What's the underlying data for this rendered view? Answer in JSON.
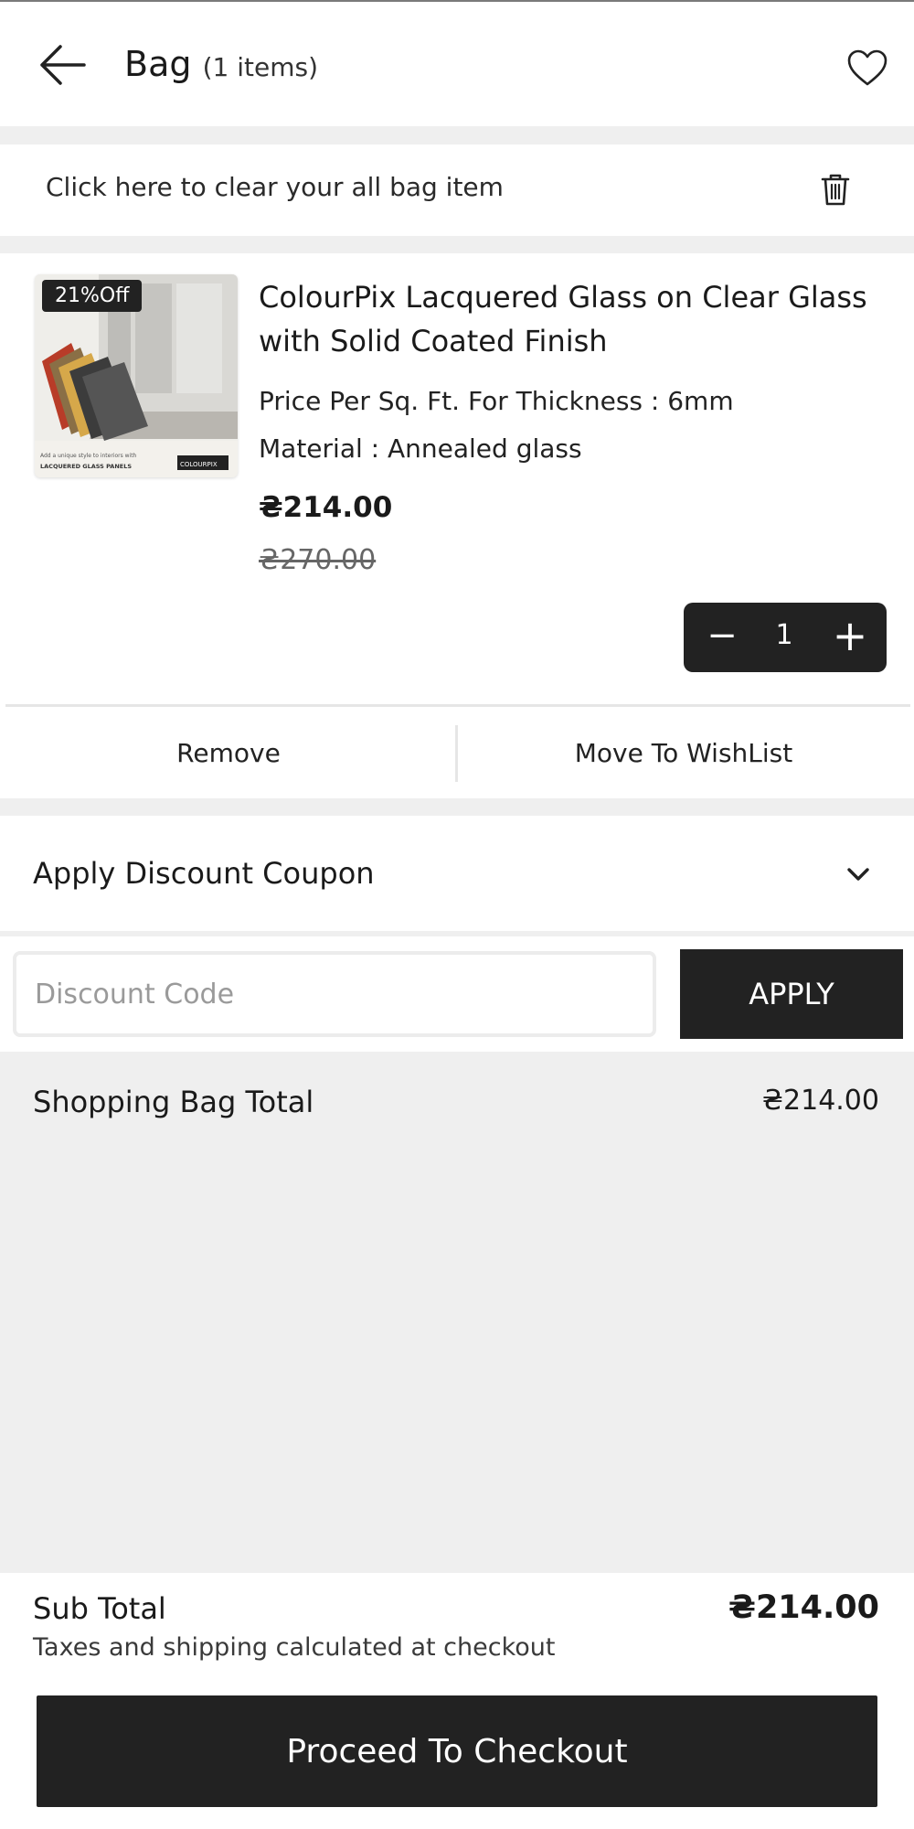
{
  "header": {
    "title": "Bag",
    "item_count_label": "(1 items)"
  },
  "clear_bar": {
    "text": "Click here to clear your all bag item"
  },
  "item": {
    "badge": "21%Off",
    "name": "ColourPix Lacquered Glass on Clear Glass with Solid Coated Finish",
    "spec_thickness": "Price Per Sq. Ft. For Thickness : 6mm",
    "spec_material": "Material : Annealed glass",
    "price": "₴214.00",
    "original_price": "₴270.00",
    "quantity": "1",
    "remove_label": "Remove",
    "move_label": "Move To WishList",
    "thumb_text_1": "Add a unique style to interiors with",
    "thumb_text_2": "LACQUERED GLASS PANELS",
    "thumb_brand": "COLOURPIX"
  },
  "coupon": {
    "heading": "Apply Discount Coupon",
    "placeholder": "Discount Code",
    "apply_label": "APPLY"
  },
  "bag_total": {
    "label": "Shopping Bag Total",
    "value": "₴214.00"
  },
  "footer": {
    "subtotal_label": "Sub Total",
    "subtotal_value": "₴214.00",
    "note": "Taxes and shipping calculated at checkout",
    "checkout_label": "Proceed To Checkout"
  },
  "icons": {
    "back": "arrow-left-icon",
    "wishlist": "heart-icon",
    "clear": "trash-icon",
    "expand": "chevron-down-icon"
  },
  "colors": {
    "primary_dark": "#222222",
    "page_bg": "#efefef"
  }
}
